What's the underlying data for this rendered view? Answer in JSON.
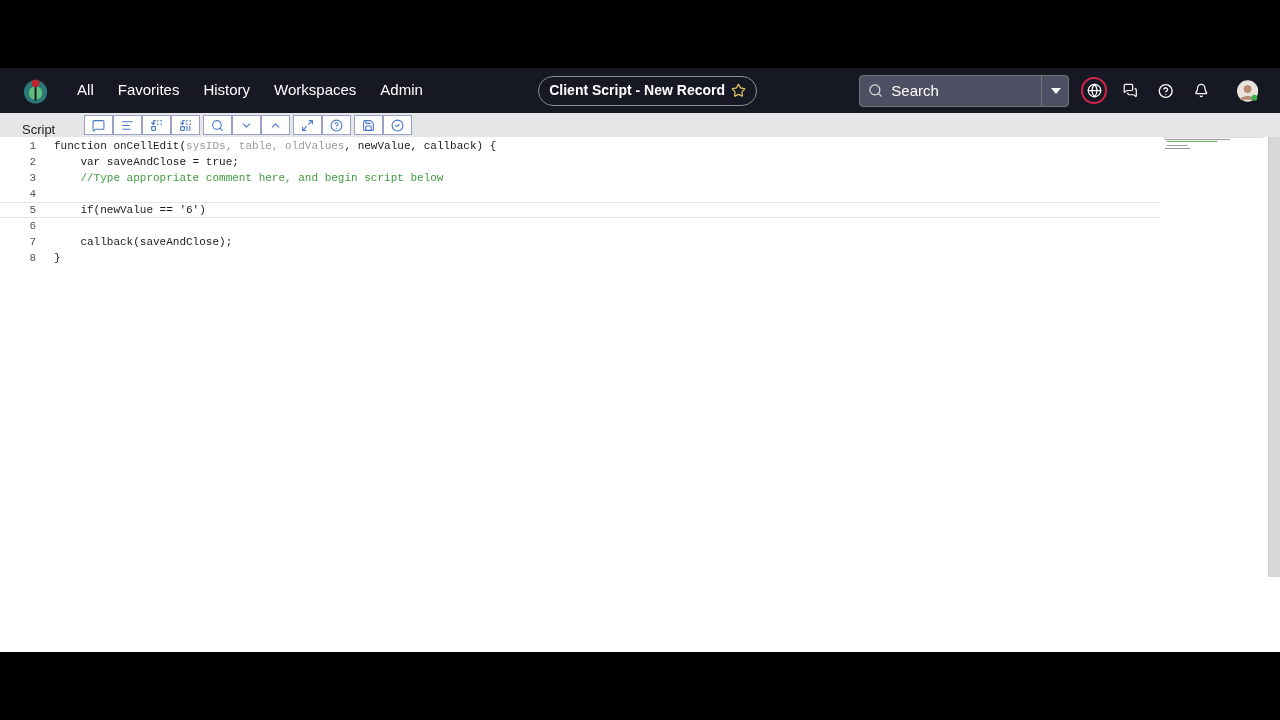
{
  "nav": {
    "items": [
      {
        "label": "All"
      },
      {
        "label": "Favorites"
      },
      {
        "label": "History"
      },
      {
        "label": "Workspaces"
      },
      {
        "label": "Admin"
      }
    ],
    "record_title": "Client Script - New Record",
    "favorite": false,
    "search": {
      "placeholder": "Search"
    }
  },
  "editor": {
    "label": "Script",
    "toolbar": [
      {
        "kind": "comment"
      },
      {
        "kind": "format"
      },
      {
        "kind": "replace"
      },
      {
        "kind": "replace-all"
      },
      {
        "kind": "search"
      },
      {
        "kind": "down"
      },
      {
        "kind": "up"
      },
      {
        "kind": "fullscreen"
      },
      {
        "kind": "help"
      },
      {
        "kind": "save"
      },
      {
        "kind": "check"
      }
    ],
    "lines": [
      {
        "number": "1",
        "current": false,
        "segments": [
          {
            "text": "function onCellEdit(",
            "kind": "code"
          },
          {
            "text": "sysIDs, table, oldValues",
            "kind": "param"
          },
          {
            "text": ", newValue, callback) {",
            "kind": "code"
          }
        ]
      },
      {
        "number": "2",
        "current": false,
        "segments": [
          {
            "text": "    var saveAndClose = true;",
            "kind": "code"
          }
        ]
      },
      {
        "number": "3",
        "current": false,
        "segments": [
          {
            "text": "    //Type appropriate comment here, and begin script below",
            "kind": "comment"
          }
        ]
      },
      {
        "number": "4",
        "current": false
      },
      {
        "number": "5",
        "current": true,
        "segments": [
          {
            "text": "    if(newValue == '6')",
            "kind": "code"
          }
        ]
      },
      {
        "number": "6",
        "current": false
      },
      {
        "number": "7",
        "current": false,
        "segments": [
          {
            "text": "    callback(saveAndClose);",
            "kind": "code"
          }
        ]
      },
      {
        "number": "8",
        "current": false,
        "segments": [
          {
            "text": "}",
            "kind": "code"
          }
        ]
      }
    ]
  }
}
